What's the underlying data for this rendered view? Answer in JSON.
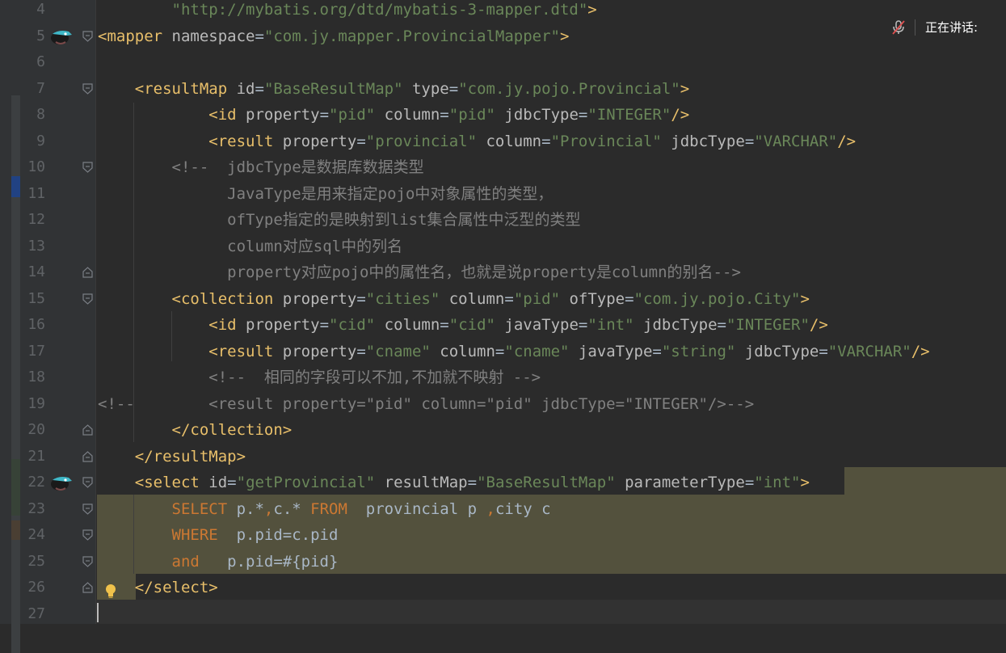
{
  "editor": {
    "lines": [
      {
        "num": "4",
        "tokens": [
          [
            "        ",
            "p"
          ],
          [
            "\"http://mybatis.org/dtd/mybatis-3-mapper.dtd\"",
            "v"
          ],
          [
            ">",
            "t"
          ]
        ]
      },
      {
        "num": "5",
        "tokens": [
          [
            "<mapper",
            "t"
          ],
          [
            " namespace",
            "a"
          ],
          [
            "=",
            "p"
          ],
          [
            "\"com.jy.mapper.ProvincialMapper\"",
            "v"
          ],
          [
            ">",
            "t"
          ]
        ]
      },
      {
        "num": "6",
        "tokens": []
      },
      {
        "num": "7",
        "tokens": [
          [
            "    ",
            "p"
          ],
          [
            "<resultMap",
            "t"
          ],
          [
            " id",
            "a"
          ],
          [
            "=",
            "p"
          ],
          [
            "\"BaseResultMap\"",
            "v"
          ],
          [
            " type",
            "a"
          ],
          [
            "=",
            "p"
          ],
          [
            "\"com.jy.pojo.Provincial\"",
            "v"
          ],
          [
            ">",
            "t"
          ]
        ]
      },
      {
        "num": "8",
        "tokens": [
          [
            "            ",
            "p"
          ],
          [
            "<id",
            "t"
          ],
          [
            " property",
            "a"
          ],
          [
            "=",
            "p"
          ],
          [
            "\"pid\"",
            "v"
          ],
          [
            " column",
            "a"
          ],
          [
            "=",
            "p"
          ],
          [
            "\"pid\"",
            "v"
          ],
          [
            " jdbcType",
            "a"
          ],
          [
            "=",
            "p"
          ],
          [
            "\"INTEGER\"",
            "v"
          ],
          [
            "/>",
            "t"
          ]
        ]
      },
      {
        "num": "9",
        "tokens": [
          [
            "            ",
            "p"
          ],
          [
            "<result",
            "t"
          ],
          [
            " property",
            "a"
          ],
          [
            "=",
            "p"
          ],
          [
            "\"provincial\"",
            "v"
          ],
          [
            " column",
            "a"
          ],
          [
            "=",
            "p"
          ],
          [
            "\"Provincial\"",
            "v"
          ],
          [
            " jdbcType",
            "a"
          ],
          [
            "=",
            "p"
          ],
          [
            "\"VARCHAR\"",
            "v"
          ],
          [
            "/>",
            "t"
          ]
        ]
      },
      {
        "num": "10",
        "tokens": [
          [
            "        <!--  jdbcType是数据库数据类型",
            "c"
          ]
        ]
      },
      {
        "num": "11",
        "tokens": [
          [
            "              JavaType是用来指定pojo中对象属性的类型，",
            "c"
          ]
        ]
      },
      {
        "num": "12",
        "tokens": [
          [
            "              ofType指定的是映射到list集合属性中泛型的类型",
            "c"
          ]
        ]
      },
      {
        "num": "13",
        "tokens": [
          [
            "              column对应sql中的列名",
            "c"
          ]
        ]
      },
      {
        "num": "14",
        "tokens": [
          [
            "              property对应pojo中的属性名，也就是说property是column的别名-->",
            "c"
          ]
        ]
      },
      {
        "num": "15",
        "tokens": [
          [
            "        ",
            "p"
          ],
          [
            "<collection",
            "t"
          ],
          [
            " property",
            "a"
          ],
          [
            "=",
            "p"
          ],
          [
            "\"cities\"",
            "v"
          ],
          [
            " column",
            "a"
          ],
          [
            "=",
            "p"
          ],
          [
            "\"pid\"",
            "v"
          ],
          [
            " ofType",
            "a"
          ],
          [
            "=",
            "p"
          ],
          [
            "\"com.jy.pojo.City\"",
            "v"
          ],
          [
            ">",
            "t"
          ]
        ]
      },
      {
        "num": "16",
        "tokens": [
          [
            "            ",
            "p"
          ],
          [
            "<id",
            "t"
          ],
          [
            " property",
            "a"
          ],
          [
            "=",
            "p"
          ],
          [
            "\"cid\"",
            "v"
          ],
          [
            " column",
            "a"
          ],
          [
            "=",
            "p"
          ],
          [
            "\"cid\"",
            "v"
          ],
          [
            " javaType",
            "a"
          ],
          [
            "=",
            "p"
          ],
          [
            "\"int\"",
            "v"
          ],
          [
            " jdbcType",
            "a"
          ],
          [
            "=",
            "p"
          ],
          [
            "\"INTEGER\"",
            "v"
          ],
          [
            "/>",
            "t"
          ]
        ]
      },
      {
        "num": "17",
        "tokens": [
          [
            "            ",
            "p"
          ],
          [
            "<result",
            "t"
          ],
          [
            " property",
            "a"
          ],
          [
            "=",
            "p"
          ],
          [
            "\"cname\"",
            "v"
          ],
          [
            " column",
            "a"
          ],
          [
            "=",
            "p"
          ],
          [
            "\"cname\"",
            "v"
          ],
          [
            " javaType",
            "a"
          ],
          [
            "=",
            "p"
          ],
          [
            "\"string\"",
            "v"
          ],
          [
            " jdbcType",
            "a"
          ],
          [
            "=",
            "p"
          ],
          [
            "\"VARCHAR\"",
            "v"
          ],
          [
            "/>",
            "t"
          ]
        ]
      },
      {
        "num": "18",
        "tokens": [
          [
            "            <!--  相同的字段可以不加,不加就不映射 -->",
            "c"
          ]
        ]
      },
      {
        "num": "19",
        "tokens": [
          [
            "<!--        <result property=\"pid\" column=\"pid\" jdbcType=\"INTEGER\"/>-->",
            "c"
          ]
        ]
      },
      {
        "num": "20",
        "tokens": [
          [
            "        ",
            "p"
          ],
          [
            "</collection>",
            "t"
          ]
        ]
      },
      {
        "num": "21",
        "tokens": [
          [
            "    ",
            "p"
          ],
          [
            "</resultMap>",
            "t"
          ]
        ]
      },
      {
        "num": "22",
        "tokens": [
          [
            "    ",
            "p"
          ],
          [
            "<select",
            "t"
          ],
          [
            " id",
            "a"
          ],
          [
            "=",
            "p"
          ],
          [
            "\"getProvincial\"",
            "v"
          ],
          [
            " resultMap",
            "a"
          ],
          [
            "=",
            "p"
          ],
          [
            "\"BaseResultMap\"",
            "v"
          ],
          [
            " parameterType",
            "a"
          ],
          [
            "=",
            "p"
          ],
          [
            "\"int\"",
            "v"
          ],
          [
            ">",
            "t"
          ]
        ]
      },
      {
        "num": "23",
        "tokens": [
          [
            "        ",
            "p"
          ],
          [
            "SELECT",
            "k"
          ],
          [
            " p.*",
            "p"
          ],
          [
            ",",
            "k"
          ],
          [
            "c.* ",
            "p"
          ],
          [
            "FROM",
            "k"
          ],
          [
            "  provincial p ",
            "p"
          ],
          [
            ",",
            "k"
          ],
          [
            "city c",
            "p"
          ]
        ]
      },
      {
        "num": "24",
        "tokens": [
          [
            "        ",
            "p"
          ],
          [
            "WHERE",
            "k"
          ],
          [
            "  p.pid=c.pid",
            "p"
          ]
        ]
      },
      {
        "num": "25",
        "tokens": [
          [
            "        ",
            "p"
          ],
          [
            "and",
            "k"
          ],
          [
            "   p.pid=#{pid}",
            "p"
          ]
        ]
      },
      {
        "num": "26",
        "tokens": [
          [
            "    ",
            "p"
          ],
          [
            "</select>",
            "t"
          ]
        ]
      },
      {
        "num": "27",
        "tokens": []
      }
    ]
  },
  "voice_indicator": {
    "label": "正在讲话:",
    "icon": "mic-muted-icon"
  },
  "colors": {
    "tag": "#e8bf6a",
    "attr": "#bababa",
    "value": "#6a8759",
    "comment": "#808080",
    "keyword": "#cc7832",
    "plain": "#a9b7c6",
    "selection": "#53513d"
  }
}
